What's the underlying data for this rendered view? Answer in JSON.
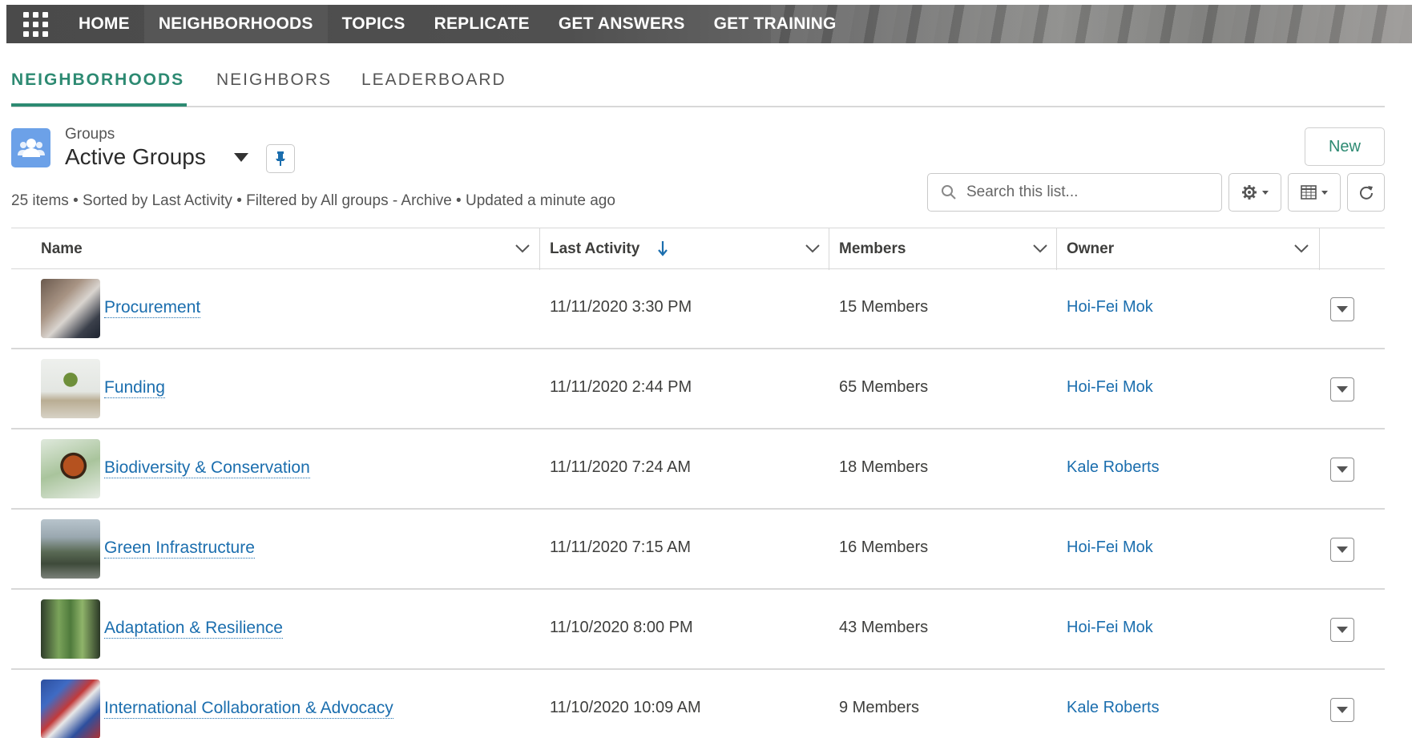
{
  "topnav": {
    "items": [
      "HOME",
      "NEIGHBORHOODS",
      "TOPICS",
      "REPLICATE",
      "GET ANSWERS",
      "GET TRAINING"
    ],
    "active": "NEIGHBORHOODS"
  },
  "subtabs": {
    "items": [
      "NEIGHBORHOODS",
      "NEIGHBORS",
      "LEADERBOARD"
    ],
    "active": "NEIGHBORHOODS"
  },
  "list": {
    "object_label": "Groups",
    "title": "Active Groups",
    "meta": "25 items • Sorted by Last Activity • Filtered by All groups - Archive • Updated a minute ago",
    "new_button": "New",
    "search_placeholder": "Search this list..."
  },
  "table": {
    "columns": [
      "Name",
      "Last Activity",
      "Members",
      "Owner"
    ],
    "rows": [
      {
        "name": "Procurement",
        "last_activity": "11/11/2020 3:30 PM",
        "members": "15 Members",
        "owner": "Hoi-Fei Mok"
      },
      {
        "name": "Funding",
        "last_activity": "11/11/2020 2:44 PM",
        "members": "65 Members",
        "owner": "Hoi-Fei Mok"
      },
      {
        "name": "Biodiversity & Conservation",
        "last_activity": "11/11/2020 7:24 AM",
        "members": "18 Members",
        "owner": "Kale Roberts"
      },
      {
        "name": "Green Infrastructure",
        "last_activity": "11/11/2020 7:15 AM",
        "members": "16 Members",
        "owner": "Hoi-Fei Mok"
      },
      {
        "name": "Adaptation & Resilience",
        "last_activity": "11/10/2020 8:00 PM",
        "members": "43 Members",
        "owner": "Hoi-Fei Mok"
      },
      {
        "name": "International Collaboration & Advocacy",
        "last_activity": "11/10/2020 10:09 AM",
        "members": "9 Members",
        "owner": "Kale Roberts"
      }
    ]
  },
  "colors": {
    "accent": "#2d8a72",
    "link": "#1b6eae",
    "group_icon": "#6ca1e8"
  }
}
